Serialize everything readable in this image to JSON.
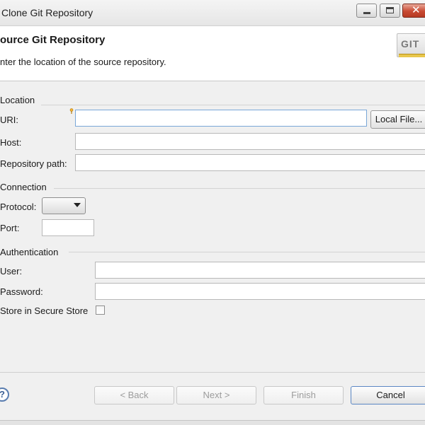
{
  "window": {
    "title": "Clone Git Repository"
  },
  "banner": {
    "title": "ource Git Repository",
    "description": "nter the location of the source repository.",
    "logo_text": "GIT"
  },
  "location": {
    "group_label": "Location",
    "uri_label": "URI:",
    "uri_value": "",
    "local_file_button": "Local File...",
    "host_label": "Host:",
    "host_value": "",
    "repo_path_label": "Repository path:",
    "repo_path_value": ""
  },
  "connection": {
    "group_label": "Connection",
    "protocol_label": "Protocol:",
    "protocol_value": "",
    "port_label": "Port:",
    "port_value": ""
  },
  "authentication": {
    "group_label": "Authentication",
    "user_label": "User:",
    "user_value": "",
    "password_label": "Password:",
    "password_value": "",
    "store_label": "Store in Secure Store",
    "store_checked": false
  },
  "footer": {
    "help_glyph": "?",
    "back_button": "< Back",
    "next_button": "Next >",
    "finish_button": "Finish",
    "cancel_button": "Cancel"
  }
}
